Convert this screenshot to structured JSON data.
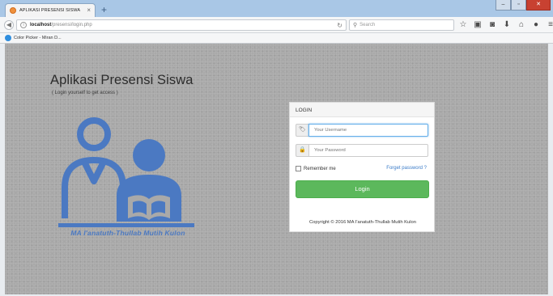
{
  "browser": {
    "tab_title": "APLIKASI PRESENSI SISWA",
    "tab_close": "×",
    "new_tab": "+",
    "url_host": "localhost",
    "url_path": "/presensi/login.php",
    "search_placeholder": "Search",
    "bookmark_label": "Color Picker - Miran D...",
    "window_buttons": [
      "–",
      "▫",
      "✕"
    ],
    "toolbar_icons": [
      "star-icon",
      "clipboard-icon",
      "pocket-icon",
      "download-icon",
      "home-icon",
      "chat-icon",
      "menu-icon"
    ]
  },
  "page": {
    "title": "Aplikasi Presensi Siswa",
    "subtitle": "( Login yourself to get access )",
    "school_name": "MA I'anatuth-Thullab Mutih Kulon",
    "logo_color": "#4b79c2"
  },
  "login": {
    "header": "LOGIN",
    "username_placeholder": "Your Username",
    "password_placeholder": "Your Password",
    "remember_label": "Remember me",
    "forgot_link": "Forget password ?",
    "button_label": "Login",
    "button_color": "#5cb85c",
    "copyright": "Copyright © 2016 MA I'anatuth-Thullab Mutih Kulon"
  }
}
